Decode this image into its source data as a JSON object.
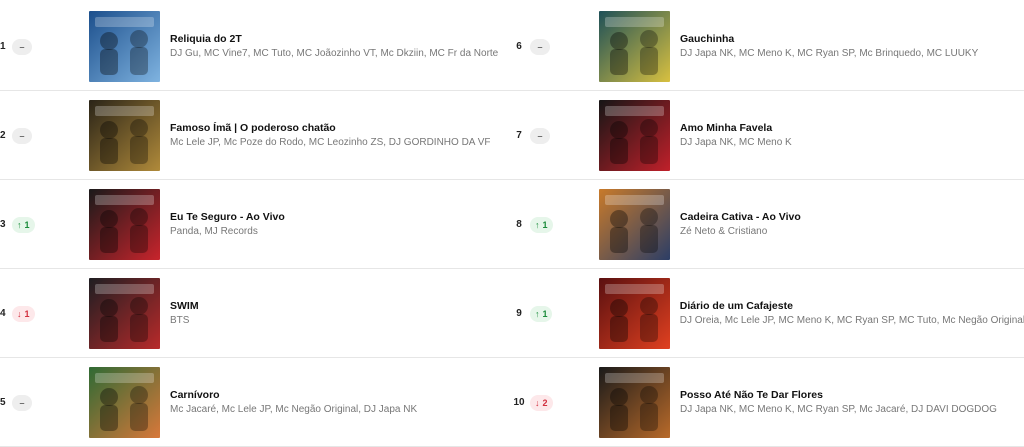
{
  "chart": {
    "entries": [
      {
        "rank": "1",
        "change": {
          "type": "same",
          "label": "–"
        },
        "title": "Reliquia do 2T",
        "artists": "DJ Gu, MC Vine7, MC Tuto, MC Joãozinho VT, Mc Dkziin, MC Fr da Norte",
        "cover_icon": "album-cover-art",
        "cover_colors": [
          "#1c4f8c",
          "#7fb3e0"
        ]
      },
      {
        "rank": "2",
        "change": {
          "type": "same",
          "label": "–"
        },
        "title": "Famoso Ímã | O poderoso chatão",
        "artists": "Mc Lele JP, Mc Poze do Rodo, MC Leozinho ZS, DJ GORDINHO DA VF",
        "cover_icon": "album-cover-art",
        "cover_colors": [
          "#2a2418",
          "#b08a3a"
        ]
      },
      {
        "rank": "3",
        "change": {
          "type": "up",
          "label": "1"
        },
        "title": "Eu Te Seguro - Ao Vivo",
        "artists": "Panda, MJ Records",
        "cover_icon": "album-cover-art",
        "cover_colors": [
          "#1a1a1a",
          "#c8242c"
        ]
      },
      {
        "rank": "4",
        "change": {
          "type": "down",
          "label": "1"
        },
        "title": "SWIM",
        "artists": "BTS",
        "cover_icon": "album-cover-art",
        "cover_colors": [
          "#1e1e22",
          "#b82a2a"
        ]
      },
      {
        "rank": "5",
        "change": {
          "type": "same",
          "label": "–"
        },
        "title": "Carnívoro",
        "artists": "Mc Jacaré, Mc Lele JP, Mc Negão Original, DJ Japa NK",
        "cover_icon": "album-cover-art",
        "cover_colors": [
          "#2f6a34",
          "#d8783a"
        ]
      },
      {
        "rank": "6",
        "change": {
          "type": "same",
          "label": "–"
        },
        "title": "Gauchinha",
        "artists": "DJ Japa NK, MC Meno K, MC Ryan SP, Mc Brinquedo, MC LUUKY",
        "cover_icon": "album-cover-art",
        "cover_colors": [
          "#1e5058",
          "#d8c040"
        ]
      },
      {
        "rank": "7",
        "change": {
          "type": "same",
          "label": "–"
        },
        "title": "Amo Minha Favela",
        "artists": "DJ Japa NK, MC Meno K",
        "cover_icon": "album-cover-art",
        "cover_colors": [
          "#161616",
          "#c0202a"
        ]
      },
      {
        "rank": "8",
        "change": {
          "type": "up",
          "label": "1"
        },
        "title": "Cadeira Cativa - Ao Vivo",
        "artists": "Zé Neto & Cristiano",
        "cover_icon": "album-cover-art",
        "cover_colors": [
          "#c87a2a",
          "#2c3e66"
        ]
      },
      {
        "rank": "9",
        "change": {
          "type": "up",
          "label": "1"
        },
        "title": "Diário de um Cafajeste",
        "artists": "DJ Oreia, Mc Lele JP, MC Meno K, MC Ryan SP, MC Tuto, Mc Negão Original",
        "cover_icon": "album-cover-art",
        "cover_colors": [
          "#5a1010",
          "#e04020"
        ]
      },
      {
        "rank": "10",
        "change": {
          "type": "down",
          "label": "2"
        },
        "title": "Posso Até Não Te Dar Flores",
        "artists": "DJ Japa NK, MC Meno K, MC Ryan SP, Mc Jacaré, DJ DAVI DOGDOG",
        "cover_icon": "album-cover-art",
        "cover_colors": [
          "#1a1a1a",
          "#b86a2a"
        ]
      }
    ]
  },
  "colors": {
    "up": "#1a8c3a",
    "down": "#d2303f",
    "same": "#666666"
  }
}
